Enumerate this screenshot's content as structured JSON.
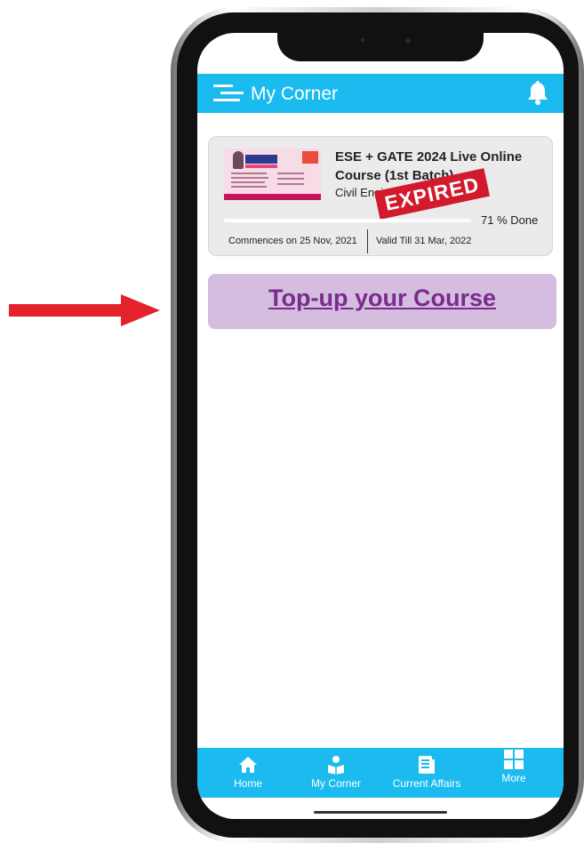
{
  "app_bar": {
    "title": "My Corner"
  },
  "course": {
    "title": "ESE + GATE 2024 Live Online Course (1st Batch)",
    "subtitle": "Civil Engineering",
    "stamp": "EXPIRED",
    "progress_percent": 71,
    "progress_text": "71 % Done",
    "commences": "Commences on 25 Nov, 2021",
    "valid_till": "Valid Till 31 Mar, 2022"
  },
  "topup": {
    "label": "Top-up your Course"
  },
  "bottom_nav": {
    "items": [
      {
        "label": "Home",
        "icon": "home-icon"
      },
      {
        "label": "My Corner",
        "icon": "reader-icon"
      },
      {
        "label": "Current Affairs",
        "icon": "newspaper-icon"
      },
      {
        "label": "More",
        "icon": "grid-icon"
      }
    ]
  },
  "colors": {
    "app_bar": "#1bbbef",
    "topup_bg": "#d4bddf",
    "topup_text": "#7b2b8c",
    "stamp": "#d31a2c",
    "arrow": "#e3222b"
  }
}
